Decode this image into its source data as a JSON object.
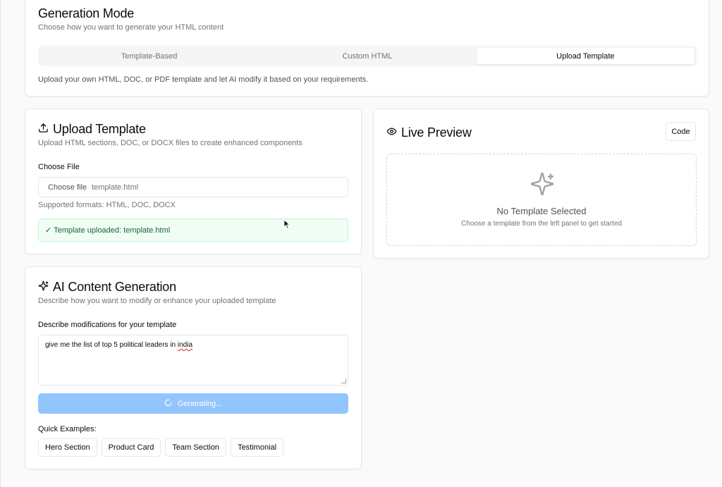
{
  "generation_mode": {
    "title": "Generation Mode",
    "subtitle": "Choose how you want to generate your HTML content",
    "tabs": [
      {
        "label": "Template-Based",
        "active": false
      },
      {
        "label": "Custom HTML",
        "active": false
      },
      {
        "label": "Upload Template",
        "active": true
      }
    ],
    "description": "Upload your own HTML, DOC, or PDF template and let AI modify it based on your requirements."
  },
  "upload_template": {
    "icon": "upload-icon",
    "title": "Upload Template",
    "subtitle": "Upload HTML sections, DOC, or DOCX files to create enhanced components",
    "file_label": "Choose File",
    "file_button": "Choose file",
    "file_name": "template.html",
    "supported": "Supported formats: HTML, DOC, DOCX",
    "success_message": "✓ Template uploaded: template.html",
    "success_color": "#f0fdf4"
  },
  "live_preview": {
    "icon": "eye-icon",
    "title": "Live Preview",
    "code_button": "Code",
    "empty_icon": "sparkles-icon",
    "empty_title": "No Template Selected",
    "empty_subtitle": "Choose a template from the left panel to get started"
  },
  "ai_generation": {
    "icon": "sparkles-icon",
    "title": "AI Content Generation",
    "subtitle": "Describe how you want to modify or enhance your uploaded template",
    "prompt_label": "Describe modifications for your template",
    "prompt_value_main": "give me the list of top 5 political leaders in ",
    "prompt_value_misspelled": "india",
    "generate_button": "Generating...",
    "generate_button_color": "#93c5fd",
    "quick_examples_label": "Quick Examples:",
    "quick_examples": [
      "Hero Section",
      "Product Card",
      "Team Section",
      "Testimonial"
    ]
  }
}
